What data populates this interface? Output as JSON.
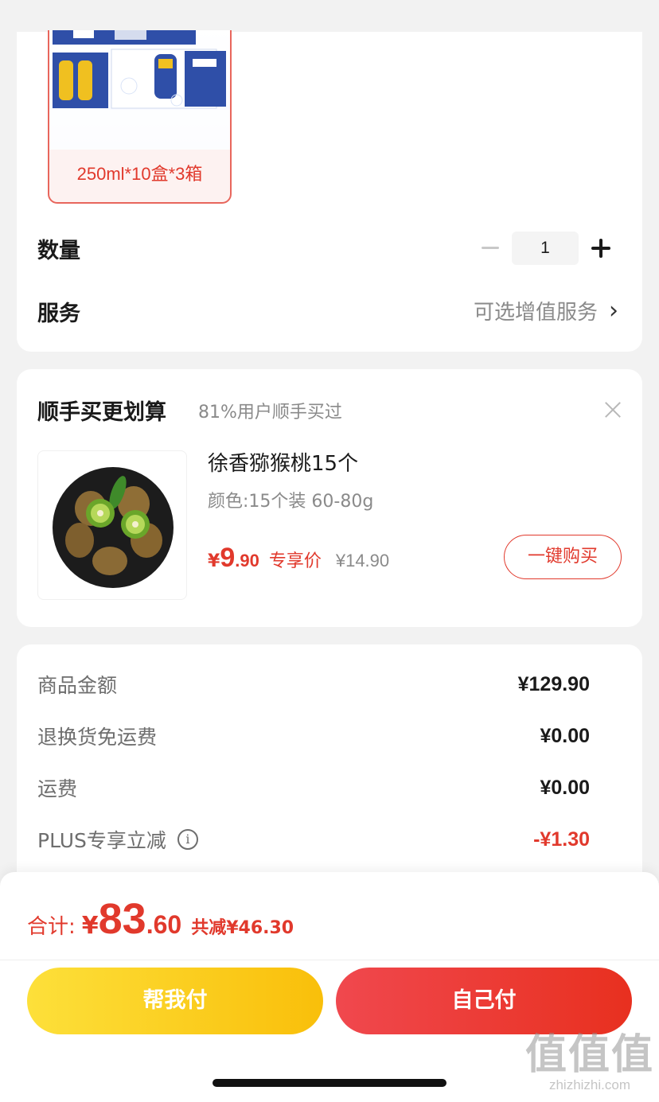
{
  "spec_card": {
    "variant_label": "250ml*10盒*3箱",
    "quantity_label": "数量",
    "quantity_value": "1",
    "service_label": "服务",
    "service_link": "可选增值服务"
  },
  "addon_card": {
    "title": "顺手买更划算",
    "subtitle": "81%用户顺手买过",
    "product_name": "徐香猕猴桃15个",
    "product_spec": "颜色:15个装  60-80g",
    "price_currency": "¥",
    "price_int": "9",
    "price_dec": ".90",
    "price_tag": "专享价",
    "original_price": "¥14.90",
    "buy_button": "一键购买"
  },
  "summary_card": {
    "rows": [
      {
        "label": "商品金额",
        "value": "¥129.90"
      },
      {
        "label": "退换货免运费",
        "value": "¥0.00"
      },
      {
        "label": "运费",
        "value": "¥0.00"
      },
      {
        "label": "PLUS专享立减",
        "value": "-¥1.30"
      }
    ]
  },
  "bottom_bar": {
    "total_label": "合计:",
    "total_currency": "¥",
    "total_int": "83",
    "total_dec": ".60",
    "total_saved": "共减¥46.30",
    "help_pay_button": "帮我付",
    "self_pay_button": "自己付"
  },
  "watermark": {
    "logo": "值值值",
    "url": "zhizhizhi.com"
  },
  "colors": {
    "accent_red": "#e1392c",
    "help_pay_yellow": "#f9bf0a",
    "background": "#f2f2f2"
  }
}
